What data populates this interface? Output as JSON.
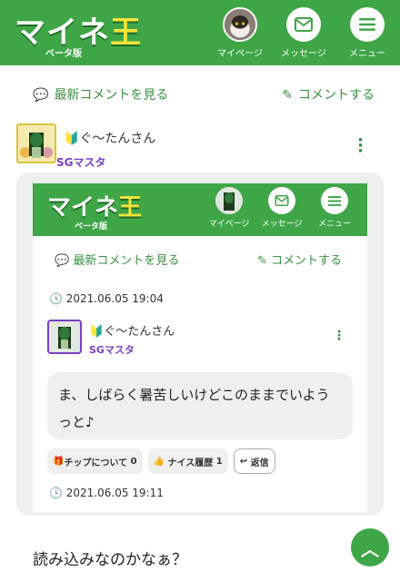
{
  "header": {
    "logo_main": "マイネ",
    "logo_ou": "王",
    "logo_sub": "ベータ版",
    "nav": [
      {
        "label": "マイページ",
        "icon": "avatar-icon"
      },
      {
        "label": "メッセージ",
        "icon": "mail-icon"
      },
      {
        "label": "メニュー",
        "icon": "menu-icon"
      }
    ]
  },
  "actions": {
    "latest_comments": "最新コメントを見る",
    "comment": "コメントする"
  },
  "post": {
    "user_name": "ぐ〜たんさん",
    "user_badge": "SGマスタ",
    "reply_text": "読み込みなのかなぁ？"
  },
  "embedded": {
    "logo_main": "マイネ",
    "logo_ou": "王",
    "logo_sub": "ベータ版",
    "nav": [
      {
        "label": "マイページ"
      },
      {
        "label": "メッセージ"
      },
      {
        "label": "メニュー"
      }
    ],
    "latest_comments": "最新コメントを見る",
    "comment": "コメントする",
    "date_top": "2021.06.05 19:04",
    "user_name": "ぐ〜たんさん",
    "user_badge": "SGマスタ",
    "message": "ま、しばらく暑苦しいけどこのままでいようっと♪",
    "btn_tip": "チップについて",
    "btn_tip_count": "0",
    "btn_nice": "ナイス履歴",
    "btn_nice_count": "1",
    "btn_reply": "返信",
    "date_bottom": "2021.06.05 19:11"
  },
  "colors": {
    "brand": "#3fa648",
    "badge": "#7b3fc4"
  }
}
